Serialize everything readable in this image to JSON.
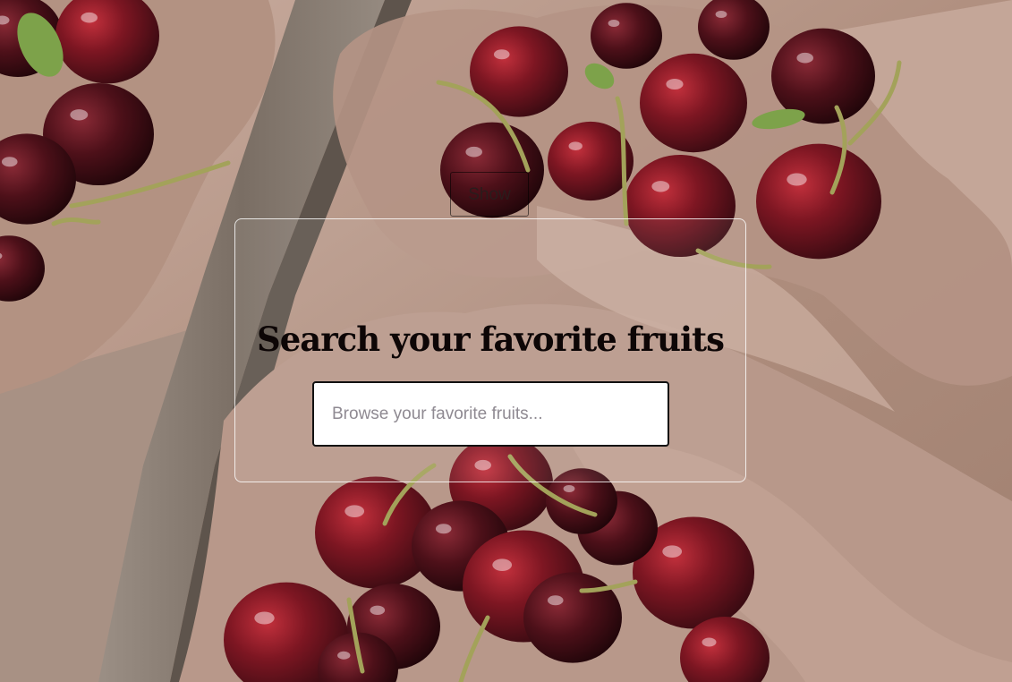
{
  "background": {
    "subject": "cherries-in-paper-bags",
    "colors": {
      "paper": "#b89a89",
      "cherry": "#7a1420",
      "wood": "#8a7d72"
    }
  },
  "toolbar": {
    "show_label": "Show"
  },
  "search": {
    "title": "Search your favorite fruits",
    "placeholder": "Browse your favorite fruits...",
    "value": ""
  }
}
